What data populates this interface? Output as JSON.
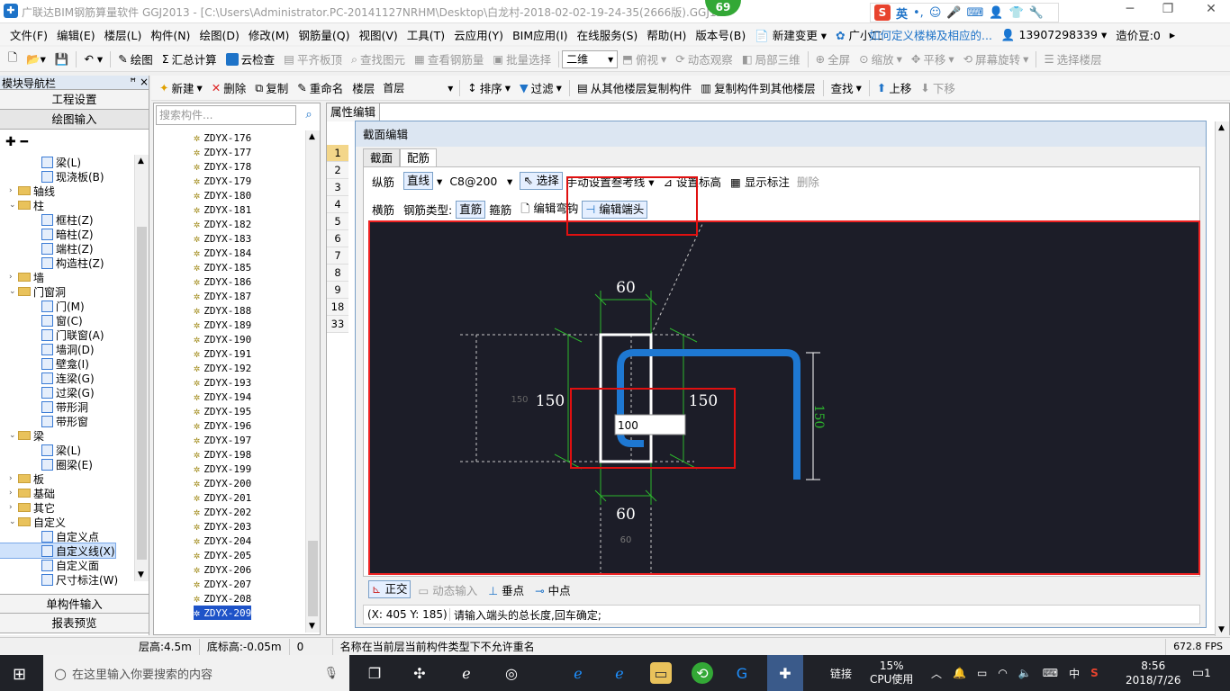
{
  "window": {
    "title": "广联达BIM钢筋算量软件 GGJ2013 - [C:\\Users\\Administrator.PC-20141127NRHM\\Desktop\\白龙村-2018-02-02-19-24-35(2666版).GGJ12",
    "badge": "69",
    "min": "─",
    "restore": "❐",
    "close": "✕"
  },
  "ime": {
    "logo": "S",
    "mode": "英"
  },
  "menu": {
    "items": [
      "文件(F)",
      "编辑(E)",
      "楼层(L)",
      "构件(N)",
      "绘图(D)",
      "修改(M)",
      "钢筋量(Q)",
      "视图(V)",
      "工具(T)",
      "云应用(Y)",
      "BIM应用(I)",
      "在线服务(S)",
      "帮助(H)",
      "版本号(B)"
    ],
    "new_change": "新建变更",
    "assistant": "广小二",
    "help_link": "如何定义楼梯及相应的...",
    "phone": "13907298339",
    "price": "造价豆:0"
  },
  "toolbar1": {
    "draw": "绘图",
    "sum": "汇总计算",
    "cloud_check": "云检查",
    "flush_slab": "平齐板顶",
    "find_elem": "查找图元",
    "view_rebar": "查看钢筋量",
    "batch_select": "批量选择",
    "view_mode": "二维",
    "top_view": "俯视",
    "dynamic_view": "动态观察",
    "local_3d": "局部三维",
    "fullscreen": "全屏",
    "zoom": "缩放",
    "pan": "平移",
    "rotate": "屏幕旋转",
    "select_floor": "选择楼层"
  },
  "toolbar2": {
    "new": "新建",
    "delete": "删除",
    "copy": "复制",
    "rename": "重命名",
    "floor_label": "楼层",
    "floor_value": "首层",
    "sort": "排序",
    "filter": "过滤",
    "copy_from": "从其他楼层复制构件",
    "copy_to": "复制构件到其他楼层",
    "find": "查找",
    "move_up": "上移",
    "move_down": "下移"
  },
  "nav": {
    "header": "模块导航栏",
    "pin": "ꟸ ×",
    "project_settings": "工程设置",
    "draw_input": "绘图输入",
    "single_input": "单构件输入",
    "report_preview": "报表预览",
    "tree": [
      {
        "label": "梁(L)",
        "kind": "leaf",
        "indent": 2
      },
      {
        "label": "现浇板(B)",
        "kind": "leaf",
        "indent": 2
      },
      {
        "label": "轴线",
        "kind": "folder",
        "indent": 1,
        "twist": "›"
      },
      {
        "label": "柱",
        "kind": "folder",
        "indent": 1,
        "twist": "⌄"
      },
      {
        "label": "框柱(Z)",
        "kind": "leaf",
        "indent": 2
      },
      {
        "label": "暗柱(Z)",
        "kind": "leaf",
        "indent": 2
      },
      {
        "label": "端柱(Z)",
        "kind": "leaf",
        "indent": 2
      },
      {
        "label": "构造柱(Z)",
        "kind": "leaf",
        "indent": 2
      },
      {
        "label": "墙",
        "kind": "folder",
        "indent": 1,
        "twist": "›"
      },
      {
        "label": "门窗洞",
        "kind": "folder",
        "indent": 1,
        "twist": "⌄"
      },
      {
        "label": "门(M)",
        "kind": "leaf",
        "indent": 2
      },
      {
        "label": "窗(C)",
        "kind": "leaf",
        "indent": 2
      },
      {
        "label": "门联窗(A)",
        "kind": "leaf",
        "indent": 2
      },
      {
        "label": "墙洞(D)",
        "kind": "leaf",
        "indent": 2
      },
      {
        "label": "壁龛(I)",
        "kind": "leaf",
        "indent": 2
      },
      {
        "label": "连梁(G)",
        "kind": "leaf",
        "indent": 2
      },
      {
        "label": "过梁(G)",
        "kind": "leaf",
        "indent": 2
      },
      {
        "label": "带形洞",
        "kind": "leaf",
        "indent": 2
      },
      {
        "label": "带形窗",
        "kind": "leaf",
        "indent": 2
      },
      {
        "label": "梁",
        "kind": "folder",
        "indent": 1,
        "twist": "⌄"
      },
      {
        "label": "梁(L)",
        "kind": "leaf",
        "indent": 2
      },
      {
        "label": "圈梁(E)",
        "kind": "leaf",
        "indent": 2
      },
      {
        "label": "板",
        "kind": "folder",
        "indent": 1,
        "twist": "›"
      },
      {
        "label": "基础",
        "kind": "folder",
        "indent": 1,
        "twist": "›"
      },
      {
        "label": "其它",
        "kind": "folder",
        "indent": 1,
        "twist": "›"
      },
      {
        "label": "自定义",
        "kind": "folder",
        "indent": 1,
        "twist": "⌄"
      },
      {
        "label": "自定义点",
        "kind": "leaf",
        "indent": 2
      },
      {
        "label": "自定义线(X)",
        "kind": "leaf",
        "indent": 2,
        "selected": true
      },
      {
        "label": "自定义面",
        "kind": "leaf",
        "indent": 2
      },
      {
        "label": "尺寸标注(W)",
        "kind": "leaf",
        "indent": 2
      }
    ]
  },
  "components": {
    "search_placeholder": "搜索构件...",
    "items": [
      "ZDYX-176",
      "ZDYX-177",
      "ZDYX-178",
      "ZDYX-179",
      "ZDYX-180",
      "ZDYX-181",
      "ZDYX-182",
      "ZDYX-183",
      "ZDYX-184",
      "ZDYX-185",
      "ZDYX-186",
      "ZDYX-187",
      "ZDYX-188",
      "ZDYX-189",
      "ZDYX-190",
      "ZDYX-191",
      "ZDYX-192",
      "ZDYX-193",
      "ZDYX-194",
      "ZDYX-195",
      "ZDYX-196",
      "ZDYX-197",
      "ZDYX-198",
      "ZDYX-199",
      "ZDYX-200",
      "ZDYX-201",
      "ZDYX-202",
      "ZDYX-203",
      "ZDYX-204",
      "ZDYX-205",
      "ZDYX-206",
      "ZDYX-207",
      "ZDYX-208",
      "ZDYX-209"
    ],
    "selected": "ZDYX-209"
  },
  "property": {
    "tab": "属性编辑",
    "rows": [
      "1",
      "2",
      "3",
      "4",
      "5",
      "6",
      "7",
      "8",
      "9",
      "18",
      "33"
    ]
  },
  "dialog": {
    "title": "截面编辑",
    "tabs": [
      "截面",
      "配筋"
    ],
    "active_tab": "配筋",
    "row1": {
      "label": "纵筋",
      "line_btn": "直线",
      "spec": "C8@200",
      "select": "选择",
      "manual": "手动设置叁考线",
      "set_elev": "设置标高",
      "show_dim": "显示标注",
      "delete": "删除"
    },
    "row2": {
      "label": "横筋",
      "type_label": "钢筋类型:",
      "straight": "直筋",
      "stirrup": "箍筋",
      "edit_hook": "编辑弯钩",
      "edit_end": "编辑端头"
    },
    "bottom": {
      "ortho": "正交",
      "dynamic": "动态输入",
      "perp": "垂点",
      "mid": "中点"
    },
    "coord": "(X: 405 Y: 185)",
    "prompt": "请输入端头的总长度,回车确定;"
  },
  "drawing": {
    "dim_top": "60",
    "dim_bottom": "60",
    "dim_bottom_small": "60",
    "dim_left": "150",
    "dim_left_small": "150",
    "dim_right": "150",
    "dim_vertical": "150",
    "input_value": "100",
    "colors": {
      "rebar": "#1e78d2",
      "dim_green": "#2db82d",
      "dim_white": "#ffffff",
      "bg": "#1c1d28"
    }
  },
  "statusbar": {
    "floor_height": "层高:4.5m",
    "base_height": "底标高:-0.05m",
    "zero": "0",
    "message": "名称在当前层当前构件类型下不允许重名",
    "fps": "672.8 FPS"
  },
  "taskbar": {
    "search_text": "在这里输入你要搜索的内容",
    "tray_link": "链接",
    "cpu_percent": "15%",
    "cpu_label": "CPU使用",
    "ime": "中",
    "time": "8:56",
    "date": "2018/7/26",
    "notif": "1"
  }
}
